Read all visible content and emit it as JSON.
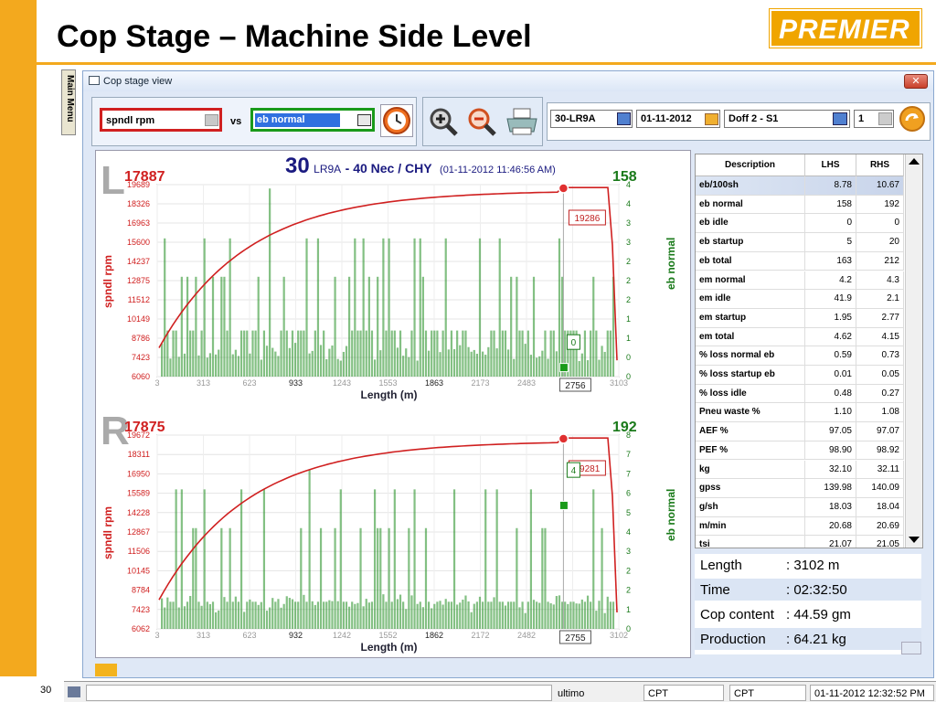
{
  "slide": {
    "title": "Cop Stage – Machine Side Level",
    "logo": "PREMIER",
    "page_number": "30"
  },
  "side_menu_label": "Main Menu",
  "window": {
    "title": "Cop stage view",
    "close_glyph": "✕"
  },
  "toolbar": {
    "metric1": "spndl rpm",
    "vs": "vs",
    "metric2": "eb normal",
    "frame": "30-LR9A",
    "date": "01-11-2012",
    "doff": "Doff 2 - S1",
    "count": "1"
  },
  "chart_data": [
    {
      "type": "bar",
      "side": "L",
      "rpm_max": "17887",
      "count": "158",
      "y_ticks": [
        "19689",
        "18326",
        "16963",
        "15600",
        "14237",
        "12875",
        "11512",
        "10149",
        "8786",
        "7423",
        "6060"
      ],
      "x_ticks": [
        "3",
        "313",
        "623",
        "933",
        "1243",
        "1553",
        "1863",
        "2173",
        "2483",
        "",
        "3103"
      ],
      "right_ticks": [
        "4",
        "4",
        "3",
        "3",
        "2",
        "2",
        "2",
        "1",
        "1",
        "0",
        "0"
      ],
      "xlabel": "Length (m)",
      "ylabel": "spndl rpm",
      "y2label": "eb normal",
      "marker_rpm": "19286",
      "marker_eb": "0",
      "marker_length": "2756",
      "ylim": [
        6060,
        19689
      ],
      "xlim": [
        3,
        3103
      ]
    },
    {
      "type": "bar",
      "side": "R",
      "rpm_max": "17875",
      "count": "192",
      "y_ticks": [
        "19672",
        "18311",
        "16950",
        "15589",
        "14228",
        "12867",
        "11506",
        "10145",
        "8784",
        "7423",
        "6062"
      ],
      "x_ticks": [
        "3",
        "313",
        "623",
        "932",
        "1242",
        "1552",
        "1862",
        "2172",
        "2482",
        "",
        "3102"
      ],
      "right_ticks": [
        "8",
        "7",
        "7",
        "6",
        "5",
        "4",
        "3",
        "2",
        "2",
        "1",
        "0"
      ],
      "xlabel": "Length (m)",
      "ylabel": "spndl rpm",
      "y2label": "eb normal",
      "marker_rpm": "19281",
      "marker_eb": "4",
      "marker_length": "2755",
      "ylim": [
        6062,
        19672
      ],
      "xlim": [
        3,
        3102
      ]
    }
  ],
  "chart_header": {
    "frame_no": "30",
    "frame_type": "LR9A",
    "count": "- 40 Nec / CHY",
    "datetime": "(01-11-2012 11:46:56 AM)"
  },
  "table": {
    "headers": [
      "Description",
      "LHS",
      "RHS"
    ],
    "rows": [
      [
        "eb/100sh",
        "8.78",
        "10.67"
      ],
      [
        "eb normal",
        "158",
        "192"
      ],
      [
        "eb idle",
        "0",
        "0"
      ],
      [
        "eb startup",
        "5",
        "20"
      ],
      [
        "eb total",
        "163",
        "212"
      ],
      [
        "em normal",
        "4.2",
        "4.3"
      ],
      [
        "em idle",
        "41.9",
        "2.1"
      ],
      [
        "em startup",
        "1.95",
        "2.77"
      ],
      [
        "em total",
        "4.62",
        "4.15"
      ],
      [
        "% loss normal eb",
        "0.59",
        "0.73"
      ],
      [
        "% loss startup eb",
        "0.01",
        "0.05"
      ],
      [
        "% loss idle",
        "0.48",
        "0.27"
      ],
      [
        "Pneu waste %",
        "1.10",
        "1.08"
      ],
      [
        "AEF %",
        "97.05",
        "97.07"
      ],
      [
        "PEF %",
        "98.90",
        "98.92"
      ],
      [
        "kg",
        "32.10",
        "32.11"
      ],
      [
        "gpss",
        "139.98",
        "140.09"
      ],
      [
        "g/sh",
        "18.03",
        "18.04"
      ],
      [
        "m/min",
        "20.68",
        "20.69"
      ],
      [
        "tsi",
        "21.07",
        "21.05"
      ]
    ]
  },
  "summary": [
    {
      "label": "Length",
      "value": ": 3102 m"
    },
    {
      "label": "Time",
      "value": ": 02:32:50"
    },
    {
      "label": "Cop content",
      "value": ": 44.59 gm"
    },
    {
      "label": "Production",
      "value": ": 64.21 kg"
    }
  ],
  "statusbar": {
    "field1": "ultimo",
    "field2": "CPT",
    "field3": "CPT",
    "field4": "01-11-2012 12:32:52 PM"
  },
  "colors": {
    "accent_orange": "#f0a500",
    "rpm_red": "#d02020",
    "bar_green": "#1e8c1e",
    "eb_green": "#1a7a1a",
    "title_blue": "#1a1a80"
  }
}
